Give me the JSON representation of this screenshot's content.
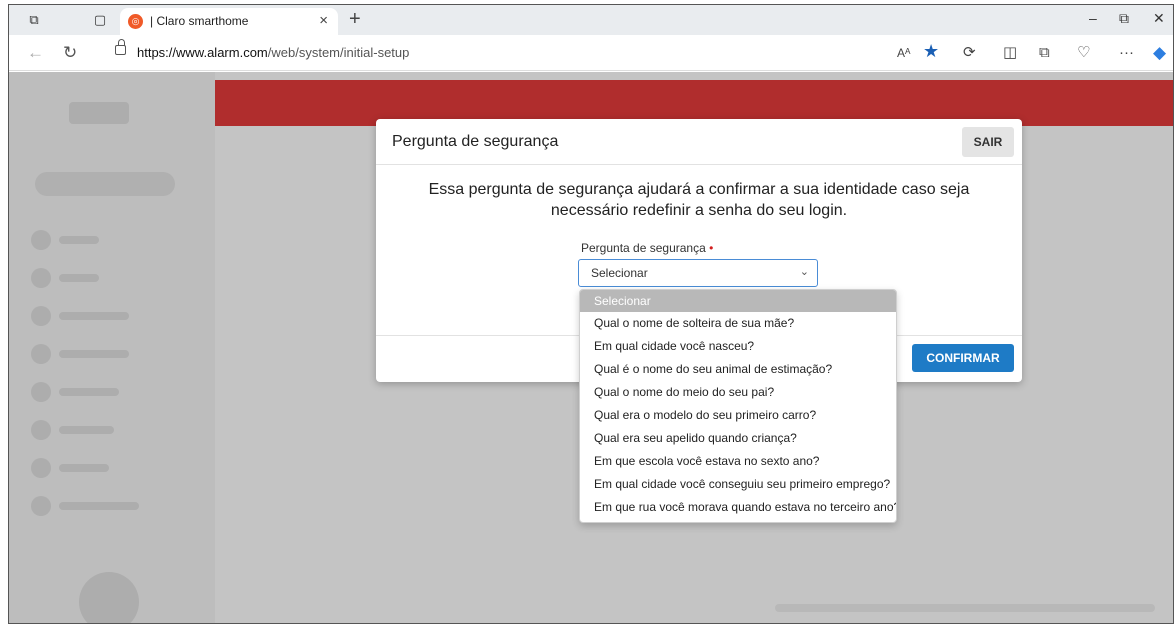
{
  "browser": {
    "tab_title": "| Claro smarthome",
    "tab_close": "×",
    "new_tab": "+",
    "url_domain": "https://www.alarm.com",
    "url_path": "/web/system/initial-setup",
    "read_aloud": "Aᴬ",
    "more": "···",
    "minimize": "–",
    "restore": "⧉",
    "close": "✕"
  },
  "modal": {
    "title": "Pergunta de segurança",
    "exit_label": "SAIR",
    "description": "Essa pergunta de segurança ajudará a confirmar a sua identidade caso seja necessário redefinir a senha do seu login.",
    "field_label": "Pergunta de segurança",
    "required_mark": "•",
    "select_value": "Selecionar",
    "confirm_label": "CONFIRMAR"
  },
  "dropdown": {
    "options": [
      "Selecionar",
      "Qual o nome de solteira de sua mãe?",
      "Em qual cidade você nasceu?",
      "Qual é o nome do seu animal de estimação?",
      "Qual o nome do meio do seu pai?",
      "Qual era o modelo do seu primeiro carro?",
      "Qual era seu apelido quando criança?",
      "Em que escola você estava no sexto ano?",
      "Em qual cidade você conseguiu seu primeiro emprego?",
      "Em que rua você morava quando estava no terceiro ano?"
    ],
    "selected_index": 0
  },
  "icons": [
    "workspaces-icon",
    "tab-actions-icon",
    "back-icon",
    "refresh-icon",
    "lock-icon",
    "favorite-star-icon",
    "extensions-icon",
    "split-screen-icon",
    "collections-icon",
    "browser-essentials-icon",
    "more-icon",
    "copilot-icon",
    "chevron-down-icon"
  ],
  "colors": {
    "header_red": "#b02d2d",
    "confirm_blue": "#1e7bc6",
    "required_red": "#d21f1f",
    "select_border": "#4a8cd6"
  }
}
